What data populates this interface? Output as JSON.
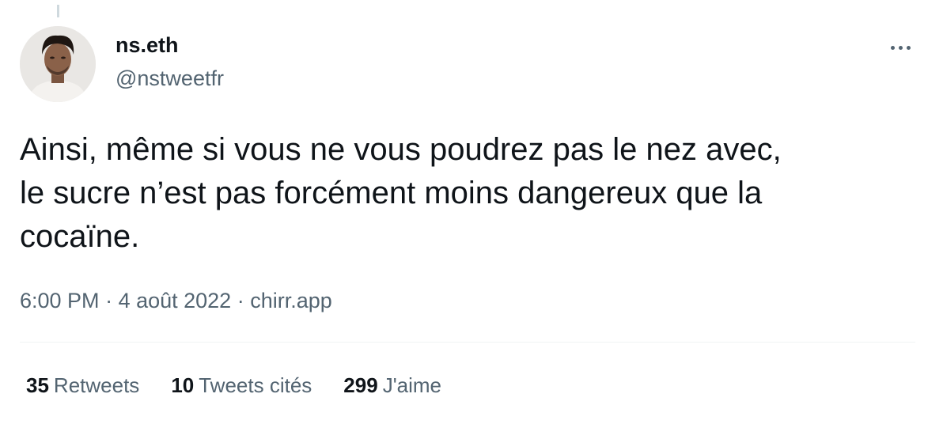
{
  "author": {
    "display_name": "ns.eth",
    "handle": "@nstweetfr"
  },
  "tweet": {
    "lines": [
      "Ainsi, même si vous ne vous poudrez pas le nez avec,",
      "le sucre n’est pas forcément moins dangereux que la",
      "cocaïne."
    ]
  },
  "meta": {
    "time": "6:00 PM",
    "separator": " · ",
    "date": "4 août 2022",
    "source": "chirr.app"
  },
  "stats": {
    "retweets": {
      "count": "35",
      "label": "Retweets"
    },
    "quotes": {
      "count": "10",
      "label": "Tweets cités"
    },
    "likes": {
      "count": "299",
      "label": "J'aime"
    }
  },
  "icons": {
    "more": "more-options-icon"
  },
  "colors": {
    "text_primary": "#0f1419",
    "text_secondary": "#536471",
    "divider": "#eff3f4"
  }
}
